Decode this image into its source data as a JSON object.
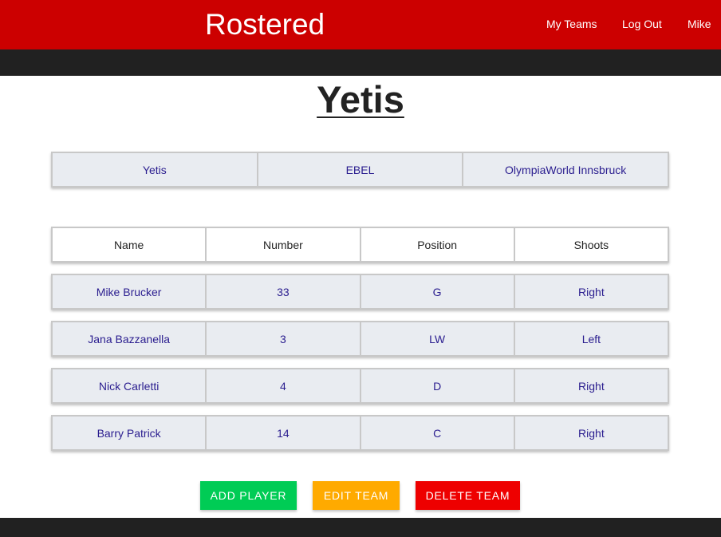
{
  "app": {
    "brand": "Rostered"
  },
  "nav": {
    "my_teams": "My Teams",
    "log_out": "Log Out",
    "user": "Mike"
  },
  "team": {
    "title": "Yetis",
    "info": [
      "Yetis",
      "EBEL",
      "OlympiaWorld Innsbruck"
    ]
  },
  "roster": {
    "headers": [
      "Name",
      "Number",
      "Position",
      "Shoots"
    ],
    "players": [
      [
        "Mike Brucker",
        "33",
        "G",
        "Right"
      ],
      [
        "Jana Bazzanella",
        "3",
        "LW",
        "Left"
      ],
      [
        "Nick Carletti",
        "4",
        "D",
        "Right"
      ],
      [
        "Barry Patrick",
        "14",
        "C",
        "Right"
      ]
    ]
  },
  "actions": {
    "add_player": "ADD PLAYER",
    "edit_team": "EDIT TEAM",
    "delete_team": "DELETE TEAM"
  },
  "colors": {
    "brand_red": "#cc0000",
    "add_green": "#00cc55",
    "edit_orange": "#ffaa00",
    "delete_red": "#ee0000"
  }
}
